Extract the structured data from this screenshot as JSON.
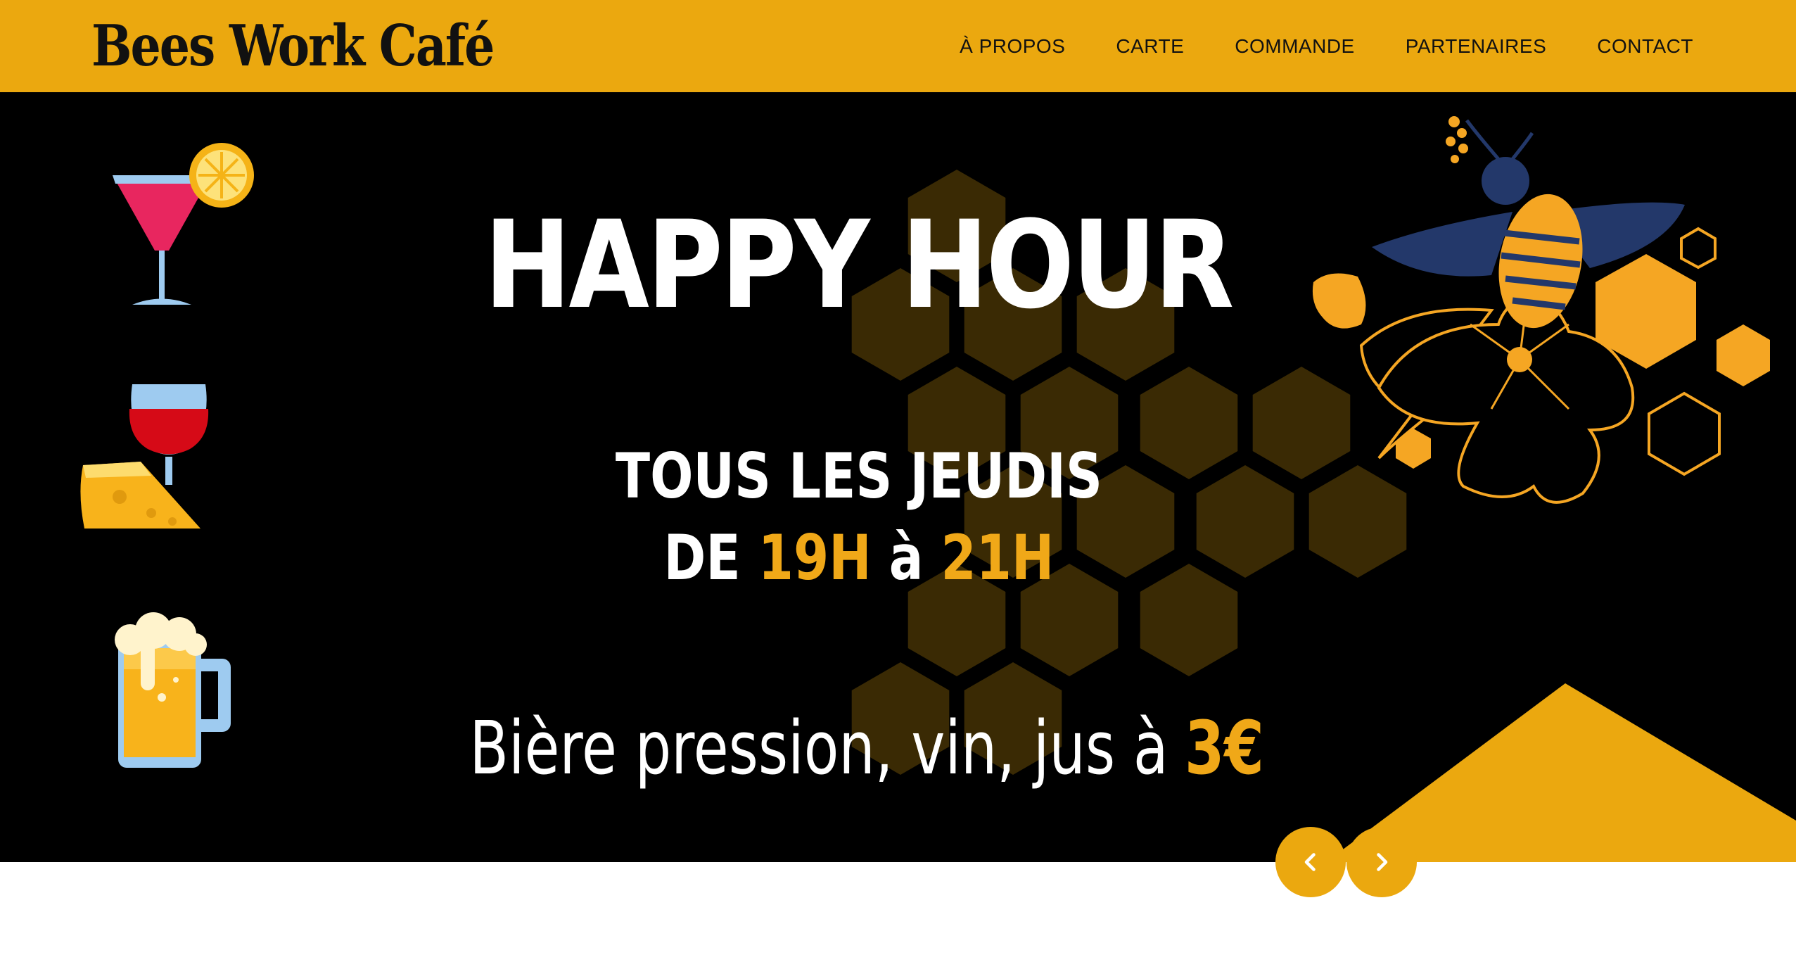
{
  "header": {
    "logo_text": "Bees Work Café",
    "nav": [
      "À PROPOS",
      "CARTE",
      "COMMANDE",
      "PARTENAIRES",
      "CONTACT"
    ]
  },
  "hero": {
    "title": "HAPPY HOUR",
    "line1": "TOUS LES JEUDIS",
    "line2_prefix": "DE ",
    "line2_start": "19H",
    "line2_mid": " à ",
    "line2_end": "21H",
    "price_text": "Bière pression, vin, jus à",
    "price_value": "3€"
  },
  "icons": [
    "cocktail-icon",
    "wine-cheese-icon",
    "beer-mug-icon",
    "bee-flower-illustration"
  ],
  "colors": {
    "brand": "#eba80f",
    "accent": "#f0a818",
    "hero_bg": "#000000",
    "honeycomb": "#3a2a04",
    "bee_wing": "#23386a"
  },
  "carousel": {
    "prev_icon": "chevron-left-icon",
    "next_icon": "chevron-right-icon"
  }
}
